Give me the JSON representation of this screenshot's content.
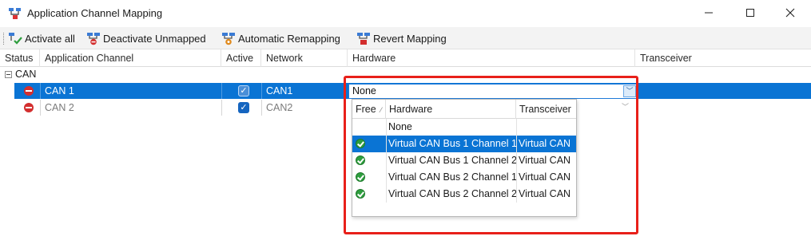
{
  "window": {
    "title": "Application Channel Mapping"
  },
  "toolbar": {
    "activate_all": "Activate all",
    "deactivate_unmapped": "Deactivate Unmapped",
    "automatic_remapping": "Automatic Remapping",
    "revert_mapping": "Revert Mapping"
  },
  "grid": {
    "columns": [
      "Status",
      "Application Channel",
      "Active",
      "Network",
      "Hardware",
      "Transceiver"
    ],
    "group": {
      "label": "CAN",
      "expanded": true
    },
    "rows": [
      {
        "channel": "CAN 1",
        "active": true,
        "network": "CAN1",
        "hardware": "None",
        "selected": true
      },
      {
        "channel": "CAN 2",
        "active": true,
        "network": "CAN2",
        "hardware": "",
        "selected": false
      }
    ]
  },
  "hardware_dropdown": {
    "columns": [
      "Free",
      "Hardware",
      "Transceiver"
    ],
    "options": [
      {
        "free": false,
        "hardware": "None",
        "transceiver": "",
        "selected": false
      },
      {
        "free": true,
        "hardware": "Virtual CAN Bus 1 Channel 1",
        "transceiver": "Virtual CAN",
        "selected": true
      },
      {
        "free": true,
        "hardware": "Virtual CAN Bus 1 Channel 2",
        "transceiver": "Virtual CAN",
        "selected": false
      },
      {
        "free": true,
        "hardware": "Virtual CAN Bus 2 Channel 1",
        "transceiver": "Virtual CAN",
        "selected": false
      },
      {
        "free": true,
        "hardware": "Virtual CAN Bus 2 Channel 2",
        "transceiver": "Virtual CAN",
        "selected": false
      }
    ]
  },
  "colors": {
    "selection": "#0a74d4",
    "highlight_box": "#e8201a",
    "status_error": "#d32f2f",
    "status_ok": "#2e9e3e"
  }
}
